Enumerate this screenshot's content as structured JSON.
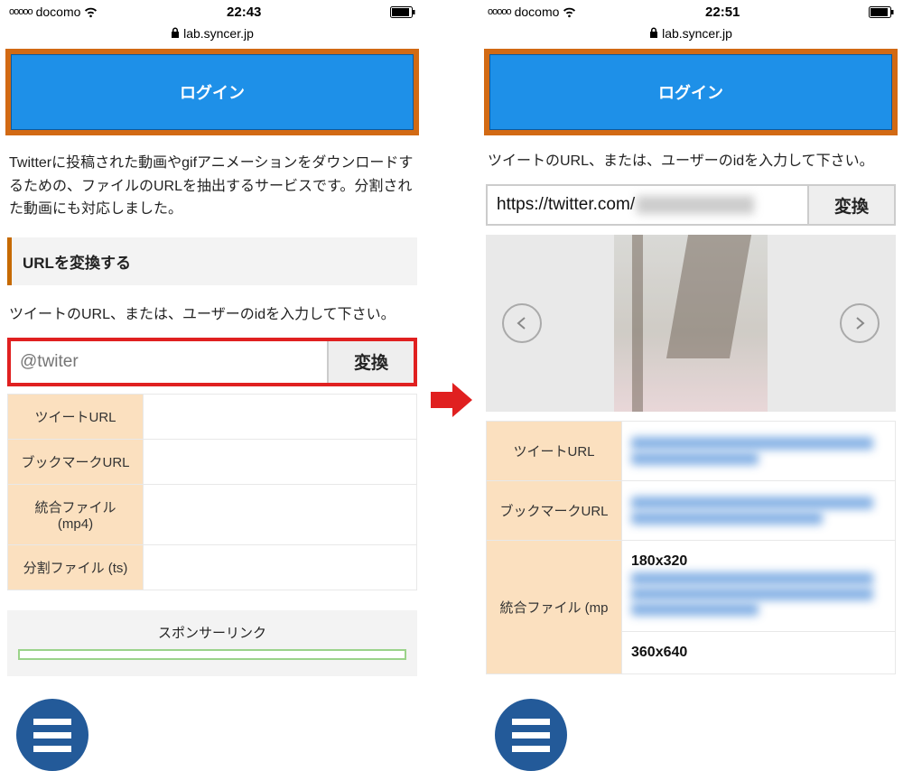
{
  "left": {
    "status": {
      "signal": "ooooo",
      "carrier": "docomo",
      "time": "22:43"
    },
    "url": "lab.syncer.jp",
    "login_label": "ログイン",
    "description": "Twitterに投稿された動画やgifアニメーションをダウンロードするための、ファイルのURLを抽出するサービスです。分割された動画にも対応しました。",
    "section_header": "URLを変換する",
    "prompt": "ツイートのURL、または、ユーザーのidを入力して下さい。",
    "input_placeholder": "@twiter",
    "convert_label": "変換",
    "table": {
      "tweet_url": "ツイートURL",
      "bookmark_url": "ブックマークURL",
      "combined_file": "統合ファイル (mp4)",
      "split_file": "分割ファイル (ts)"
    },
    "sponsor": "スポンサーリンク"
  },
  "right": {
    "status": {
      "signal": "ooooo",
      "carrier": "docomo",
      "time": "22:51"
    },
    "url": "lab.syncer.jp",
    "login_label": "ログイン",
    "prompt": "ツイートのURL、または、ユーザーのidを入力して下さい。",
    "input_value": "https://twitter.com/",
    "convert_label": "変換",
    "table": {
      "tweet_url": "ツイートURL",
      "bookmark_url": "ブックマークURL",
      "res1": "180x320",
      "res2": "360x640",
      "combined_file": "統合ファイル (mp"
    }
  }
}
